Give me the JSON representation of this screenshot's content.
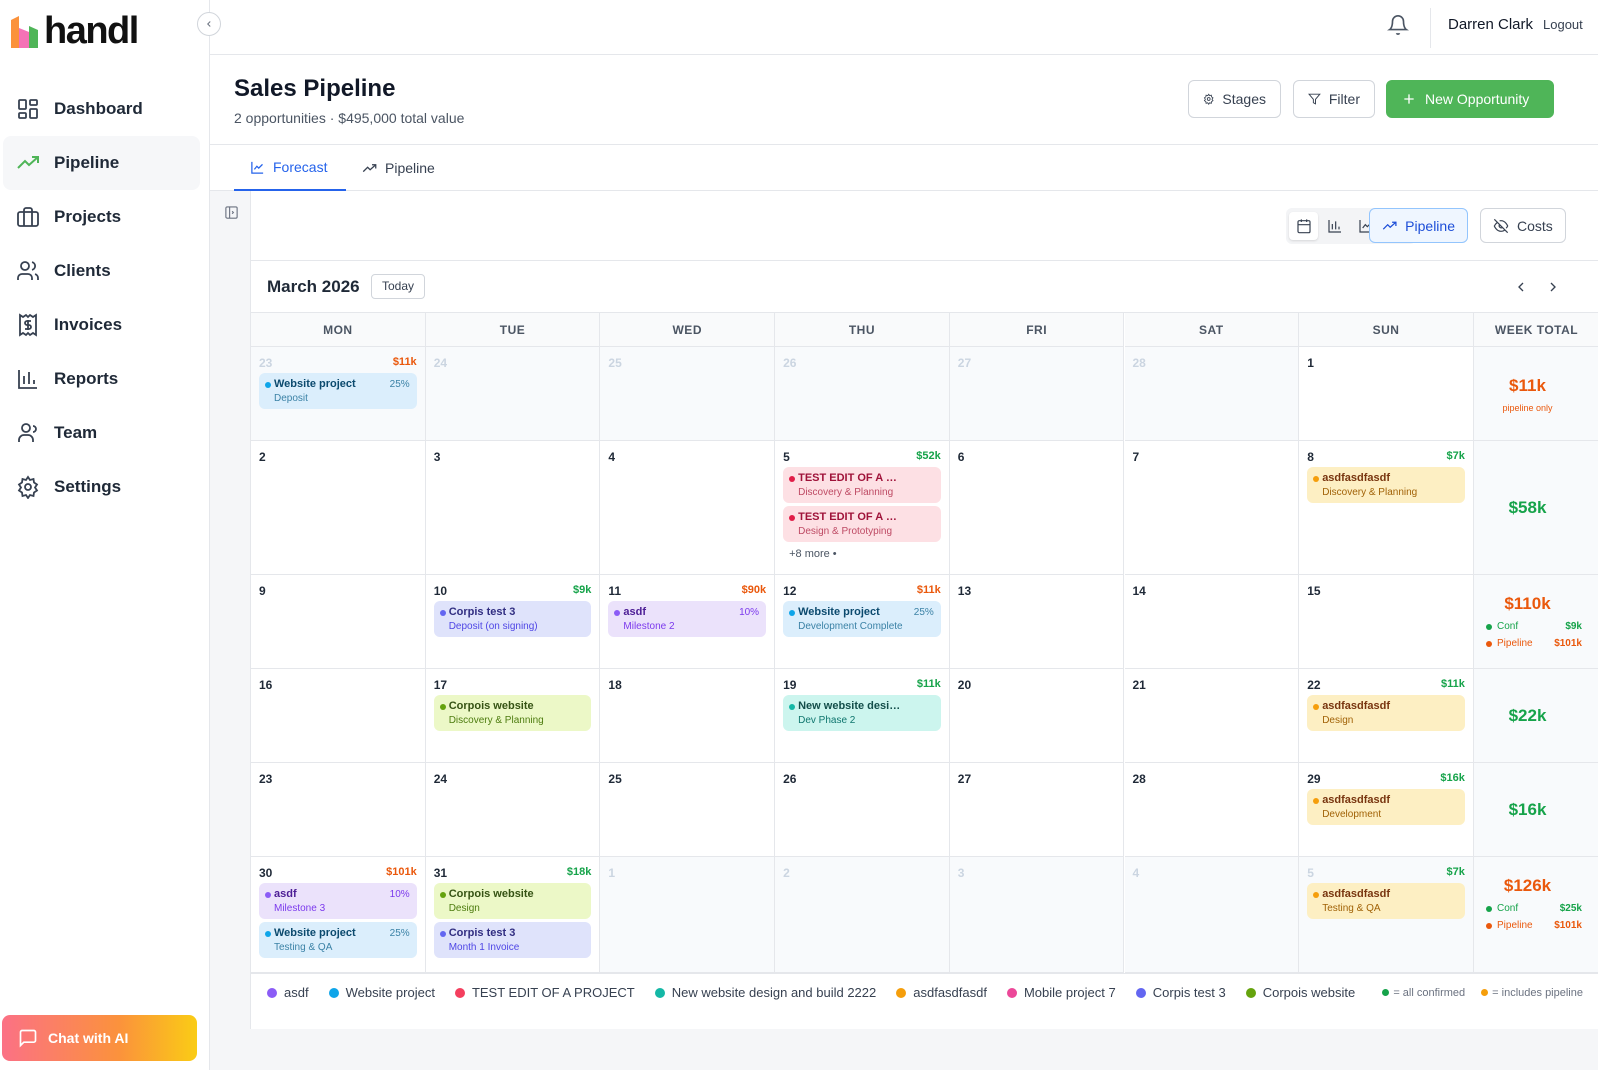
{
  "app": {
    "logo_text": "handl"
  },
  "sidebar": {
    "items": [
      {
        "label": "Dashboard",
        "icon": "dashboard-icon"
      },
      {
        "label": "Pipeline",
        "icon": "trending-up-icon",
        "active": true
      },
      {
        "label": "Projects",
        "icon": "briefcase-icon"
      },
      {
        "label": "Clients",
        "icon": "users-icon"
      },
      {
        "label": "Invoices",
        "icon": "receipt-icon"
      },
      {
        "label": "Reports",
        "icon": "bar-chart-icon"
      },
      {
        "label": "Team",
        "icon": "team-icon"
      },
      {
        "label": "Settings",
        "icon": "gear-icon"
      }
    ],
    "chat_label": "Chat with AI"
  },
  "topbar": {
    "user_name": "Darren Clark",
    "logout_label": "Logout"
  },
  "header": {
    "title": "Sales Pipeline",
    "subtitle": "2 opportunities · $495,000 total value",
    "stages_label": "Stages",
    "filter_label": "Filter",
    "new_label": "New Opportunity"
  },
  "tabs": [
    {
      "label": "Forecast",
      "active": true
    },
    {
      "label": "Pipeline",
      "active": false
    }
  ],
  "toolbar": {
    "pipeline_label": "Pipeline",
    "costs_label": "Costs"
  },
  "calendar": {
    "month_title": "March 2026",
    "today_label": "Today",
    "day_headers": [
      "MON",
      "TUE",
      "WED",
      "THU",
      "FRI",
      "SAT",
      "SUN"
    ],
    "week_total_header": "WEEK TOTAL",
    "weeks": [
      {
        "days": [
          {
            "num": "23",
            "other": true,
            "amount": "$11k",
            "amount_type": "pipeline",
            "events": [
              {
                "title": "Website project",
                "sub": "Deposit",
                "pct": "25%",
                "color": "blue"
              }
            ]
          },
          {
            "num": "24",
            "other": true
          },
          {
            "num": "25",
            "other": true
          },
          {
            "num": "26",
            "other": true
          },
          {
            "num": "27",
            "other": true
          },
          {
            "num": "28",
            "other": true
          },
          {
            "num": "1"
          }
        ],
        "total": {
          "amount": "$11k",
          "type": "pipeline",
          "note": "pipeline only"
        }
      },
      {
        "days": [
          {
            "num": "2"
          },
          {
            "num": "3"
          },
          {
            "num": "4"
          },
          {
            "num": "5",
            "amount": "$52k",
            "amount_type": "confirmed",
            "events": [
              {
                "title": "TEST EDIT OF A PROJECT",
                "sub": "Discovery & Planning",
                "color": "red"
              },
              {
                "title": "TEST EDIT OF A PROJECT",
                "sub": "Design & Prototyping",
                "color": "red"
              }
            ],
            "more": "+8 more •"
          },
          {
            "num": "6"
          },
          {
            "num": "7"
          },
          {
            "num": "8",
            "amount": "$7k",
            "amount_type": "confirmed",
            "events": [
              {
                "title": "asdfasdfasdf",
                "sub": "Discovery & Planning",
                "color": "orange"
              }
            ]
          }
        ],
        "total": {
          "amount": "$58k",
          "type": "confirmed"
        }
      },
      {
        "days": [
          {
            "num": "9"
          },
          {
            "num": "10",
            "amount": "$9k",
            "amount_type": "confirmed",
            "events": [
              {
                "title": "Corpis test 3",
                "sub": "Deposit (on signing)",
                "color": "indigo"
              }
            ]
          },
          {
            "num": "11",
            "amount": "$90k",
            "amount_type": "pipeline",
            "events": [
              {
                "title": "asdf",
                "sub": "Milestone 2",
                "pct": "10%",
                "color": "purple"
              }
            ]
          },
          {
            "num": "12",
            "amount": "$11k",
            "amount_type": "pipeline",
            "events": [
              {
                "title": "Website project",
                "sub": "Development Complete",
                "pct": "25%",
                "color": "blue"
              }
            ]
          },
          {
            "num": "13"
          },
          {
            "num": "14"
          },
          {
            "num": "15"
          }
        ],
        "total": {
          "amount": "$110k",
          "type": "pipeline",
          "conf_label": "Conf",
          "conf_value": "$9k",
          "pipe_label": "Pipeline",
          "pipe_value": "$101k"
        }
      },
      {
        "days": [
          {
            "num": "16"
          },
          {
            "num": "17",
            "events": [
              {
                "title": "Corpois website",
                "sub": "Discovery & Planning",
                "color": "lime"
              }
            ]
          },
          {
            "num": "18"
          },
          {
            "num": "19",
            "amount": "$11k",
            "amount_type": "confirmed",
            "events": [
              {
                "title": "New website design and build 2222",
                "sub": "Dev Phase 2",
                "color": "teal"
              }
            ]
          },
          {
            "num": "20"
          },
          {
            "num": "21"
          },
          {
            "num": "22",
            "amount": "$11k",
            "amount_type": "confirmed",
            "events": [
              {
                "title": "asdfasdfasdf",
                "sub": "Design",
                "color": "orange"
              }
            ]
          }
        ],
        "total": {
          "amount": "$22k",
          "type": "confirmed"
        }
      },
      {
        "days": [
          {
            "num": "23"
          },
          {
            "num": "24"
          },
          {
            "num": "25"
          },
          {
            "num": "26"
          },
          {
            "num": "27"
          },
          {
            "num": "28"
          },
          {
            "num": "29",
            "amount": "$16k",
            "amount_type": "confirmed",
            "events": [
              {
                "title": "asdfasdfasdf",
                "sub": "Development",
                "color": "orange"
              }
            ]
          }
        ],
        "total": {
          "amount": "$16k",
          "type": "confirmed"
        }
      },
      {
        "days": [
          {
            "num": "30",
            "amount": "$101k",
            "amount_type": "pipeline",
            "events": [
              {
                "title": "asdf",
                "sub": "Milestone 3",
                "pct": "10%",
                "color": "purple"
              },
              {
                "title": "Website project",
                "sub": "Testing & QA",
                "pct": "25%",
                "color": "blue"
              }
            ]
          },
          {
            "num": "31",
            "amount": "$18k",
            "amount_type": "confirmed",
            "events": [
              {
                "title": "Corpois website",
                "sub": "Design",
                "color": "lime"
              },
              {
                "title": "Corpis test 3",
                "sub": "Month 1 Invoice",
                "color": "indigo"
              }
            ]
          },
          {
            "num": "1",
            "other": true
          },
          {
            "num": "2",
            "other": true
          },
          {
            "num": "3",
            "other": true
          },
          {
            "num": "4",
            "other": true
          },
          {
            "num": "5",
            "other": true,
            "amount": "$7k",
            "amount_type": "confirmed",
            "events": [
              {
                "title": "asdfasdfasdf",
                "sub": "Testing & QA",
                "color": "orange"
              }
            ]
          }
        ],
        "total": {
          "amount": "$126k",
          "type": "pipeline",
          "conf_label": "Conf",
          "conf_value": "$25k",
          "pipe_label": "Pipeline",
          "pipe_value": "$101k"
        }
      }
    ]
  },
  "legend": [
    {
      "label": "asdf",
      "color": "#8b5cf6"
    },
    {
      "label": "Website project",
      "color": "#0ea5e9"
    },
    {
      "label": "TEST EDIT OF A PROJECT",
      "color": "#f43f5e"
    },
    {
      "label": "New website design and build 2222",
      "color": "#14b8a6"
    },
    {
      "label": "asdfasdfasdf",
      "color": "#f59e0b"
    },
    {
      "label": "Mobile project 7",
      "color": "#ec4899"
    },
    {
      "label": "Corpis test 3",
      "color": "#6366f1"
    },
    {
      "label": "Corpois website",
      "color": "#65a30d"
    }
  ],
  "legend_notes": {
    "confirmed": "= all confirmed",
    "pipeline": "= includes pipeline"
  },
  "colors": {
    "accent_green": "#4fb558",
    "confirmed": "#16a34a",
    "pipeline": "#ea580c",
    "link_blue": "#2563eb",
    "event": {
      "blue": {
        "bg": "#dbeefc",
        "dot": "#0ea5e9",
        "title": "#0c4a6e",
        "sub": "#3b82a6"
      },
      "red": {
        "bg": "#fde0e4",
        "dot": "#e11d48",
        "title": "#9f1239",
        "sub": "#be4a64"
      },
      "orange": {
        "bg": "#fdefc3",
        "dot": "#f59e0b",
        "title": "#78350f",
        "sub": "#a16207"
      },
      "indigo": {
        "bg": "#dfe3fb",
        "dot": "#6366f1",
        "title": "#312e81",
        "sub": "#4f46e5"
      },
      "purple": {
        "bg": "#ebe2fb",
        "dot": "#8b5cf6",
        "title": "#4c1d95",
        "sub": "#7c3aed"
      },
      "lime": {
        "bg": "#ecf8c7",
        "dot": "#65a30d",
        "title": "#365314",
        "sub": "#4d7c0f"
      },
      "teal": {
        "bg": "#ccf5ee",
        "dot": "#14b8a6",
        "title": "#134e4a",
        "sub": "#0f766e"
      }
    }
  }
}
